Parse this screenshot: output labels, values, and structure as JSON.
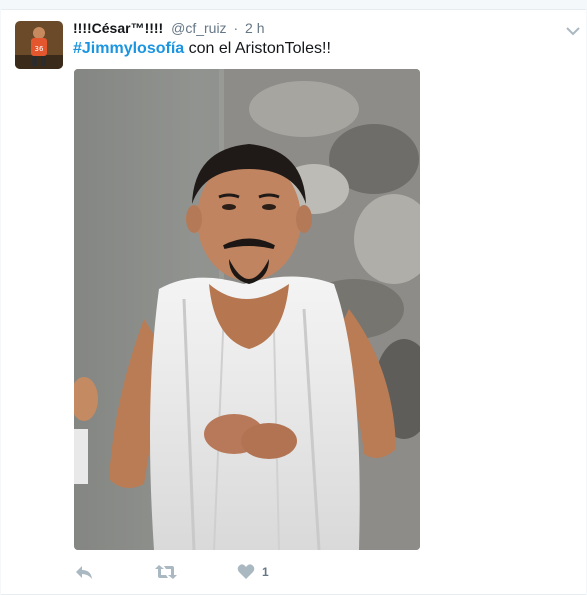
{
  "tweet": {
    "author": {
      "display_name": "!!!!César™!!!!",
      "handle": "@cf_ruiz",
      "separator": "·",
      "timestamp": "2 h",
      "avatar_icon": "user-avatar",
      "avatar_shirt_number": "36"
    },
    "text": {
      "hashtag": "#Jimmylosofía",
      "rest": " con el  AristonToles!!"
    },
    "actions": {
      "reply_icon": "reply-icon",
      "retweet_icon": "retweet-icon",
      "like_icon": "heart-icon",
      "like_count": "1"
    },
    "colors": {
      "link": "#1b95e0",
      "muted": "#657786",
      "icon": "#aab8c2",
      "text": "#14171a"
    }
  }
}
